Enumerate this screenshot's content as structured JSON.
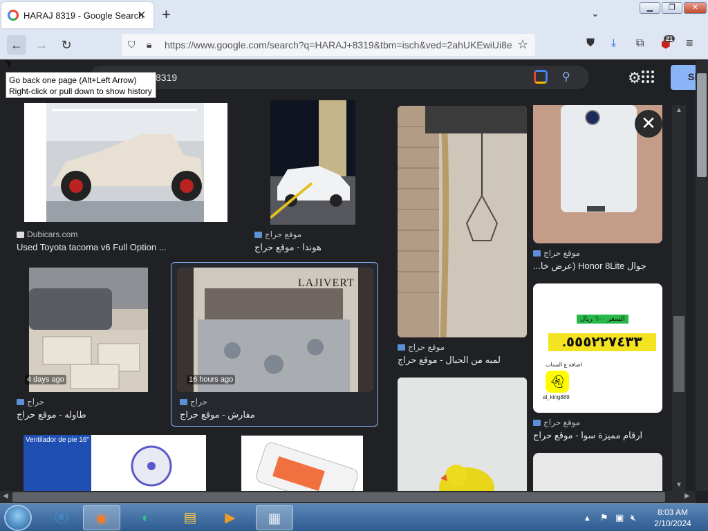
{
  "browser": {
    "tab_title": "HARAJ 8319 - Google Search",
    "tab_close": "✕",
    "new_tab": "+",
    "tab_list": "⌄",
    "url": "https://www.google.com/search?q=HARAJ+8319&tbm=isch&ved=2ahUKEwiUi8e",
    "ext_badge": "21"
  },
  "tooltip": {
    "line1": "Go back one page (Alt+Left Arrow)",
    "line2": "Right-click or pull down to show history"
  },
  "search": {
    "query_visible": "8319",
    "signin_label": "Si"
  },
  "results": [
    {
      "source": "Dubicars.com",
      "caption": "Used Toyota tacoma v6 Full Option ...",
      "age": ""
    },
    {
      "source": "موقع حراج",
      "caption": "هوندا - موقع حراج",
      "age": ""
    },
    {
      "source": "حراج",
      "caption": "طاوله - موقع حراج",
      "age": "4 days ago"
    },
    {
      "source": "حراج",
      "caption": "مفارش - موقع حراج",
      "age": "16 hours ago"
    },
    {
      "source": "موقع حراج",
      "caption": "لمبه من الحبال - موقع حراج",
      "age": ""
    }
  ],
  "panel": {
    "item1_source": "موقع حراج",
    "item1_caption": "جوال Honor 8Lite (عرض خا...",
    "item2_source": "موقع حراج",
    "item2_caption": "ارقام مميزة سوا - موقع حراج",
    "item2_price": "السعر ٦٠٠ ريال",
    "item2_number": ".٥٥٥٢٢٧٤٣٣",
    "item2_user": "al_king889",
    "item2_snap_label": "اضافة ع السناب",
    "close_label": "✕"
  },
  "images": {
    "bed_brand": "LAJIVERT",
    "fan_label": "Ventilador de pie 16\""
  },
  "taskbar": {
    "time": "8:03 AM",
    "date": "2/10/2024"
  },
  "colors": {
    "background": "#202124",
    "accent": "#8ab4f8",
    "caption": "#e8eaed",
    "source": "#bdc1c6"
  }
}
